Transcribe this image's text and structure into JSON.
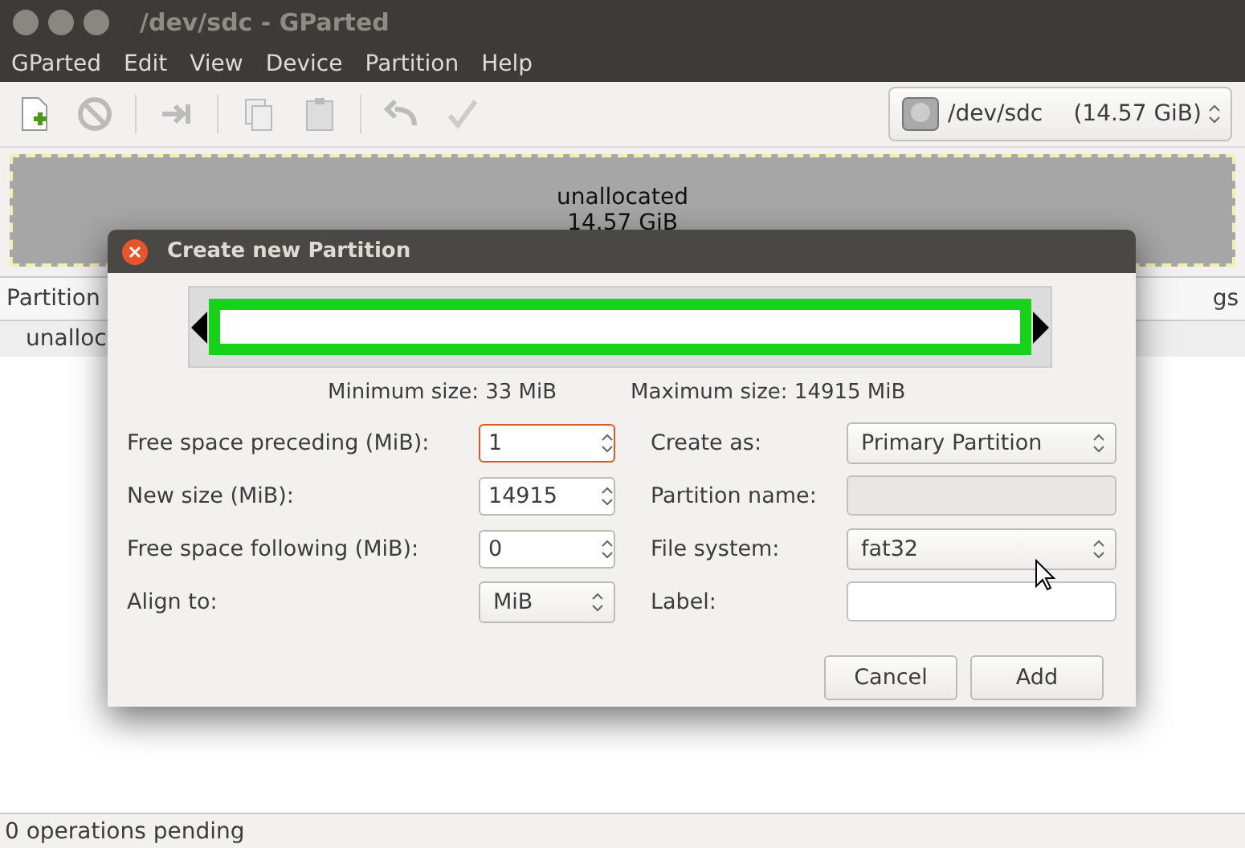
{
  "window": {
    "title": "/dev/sdc - GParted"
  },
  "menu": [
    "GParted",
    "Edit",
    "View",
    "Device",
    "Partition",
    "Help"
  ],
  "device": {
    "name": "/dev/sdc",
    "size": "(14.57 GiB)"
  },
  "disk_map": {
    "label": "unallocated",
    "size": "14.57 GiB"
  },
  "table": {
    "columns": [
      "Partition",
      "gs"
    ],
    "rows": [
      [
        "unalloc"
      ]
    ]
  },
  "status_bar": "0 operations pending",
  "dialog": {
    "title": "Create new Partition",
    "size_bar": {
      "level": 1
    },
    "min_size": "Minimum size: 33 MiB",
    "max_size": "Maximum size: 14915 MiB",
    "left_fields": [
      {
        "label": "Free space preceding (MiB):",
        "value": "1",
        "kind": "spin",
        "focused": true
      },
      {
        "label": "New size (MiB):",
        "value": "14915",
        "kind": "spin",
        "focused": false
      },
      {
        "label": "Free space following (MiB):",
        "value": "0",
        "kind": "spin",
        "focused": false
      },
      {
        "label": "Align to:",
        "value": "MiB",
        "kind": "combo"
      }
    ],
    "right_fields": [
      {
        "label": "Create as:",
        "value": "Primary Partition",
        "kind": "combo"
      },
      {
        "label": "Partition name:",
        "kind": "entry",
        "disabled": true
      },
      {
        "label": "File system:",
        "value": "fat32",
        "kind": "combo"
      },
      {
        "label": "Label:",
        "kind": "entry",
        "disabled": false
      }
    ],
    "buttons": [
      "Cancel",
      "Add"
    ]
  }
}
